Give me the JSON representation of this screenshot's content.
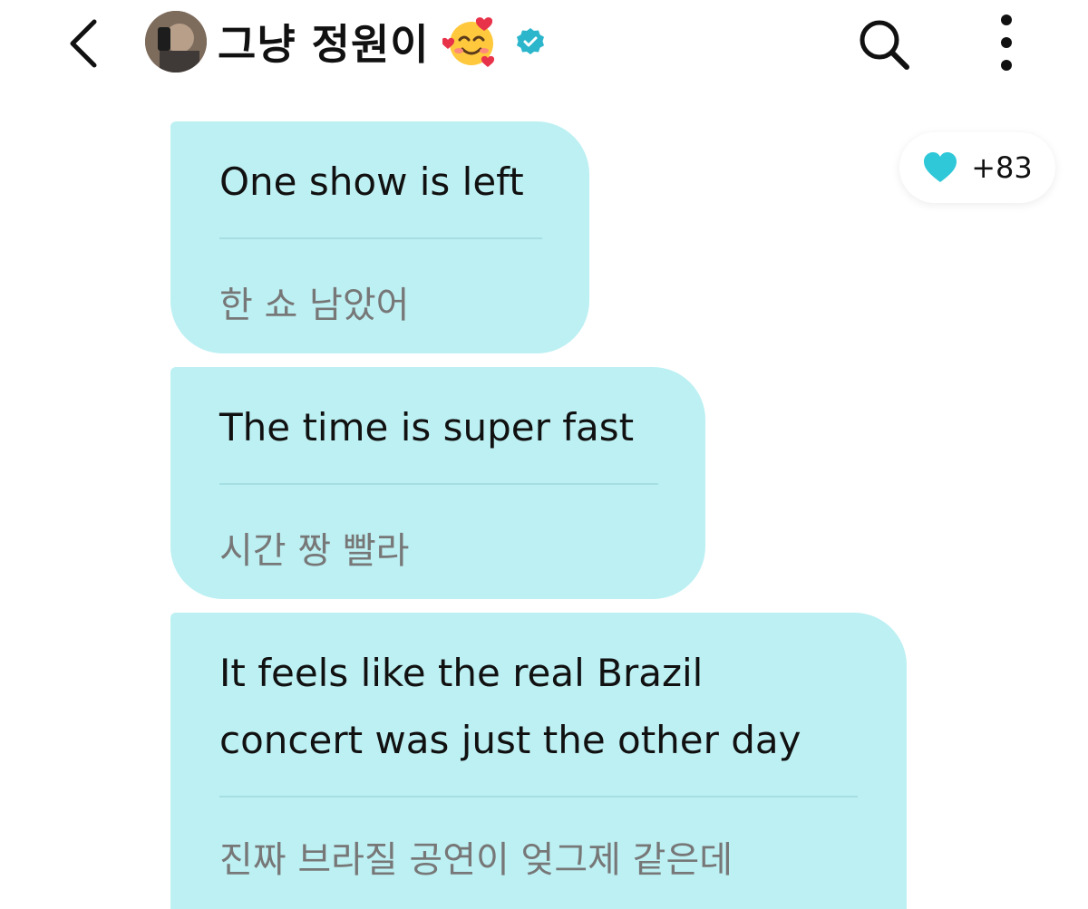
{
  "header": {
    "title": "그냥 정원이",
    "back_icon": "chevron-left-icon",
    "search_icon": "search-icon",
    "more_icon": "more-vertical-icon",
    "verified_color": "#2bb6cc"
  },
  "reaction": {
    "icon": "heart-icon",
    "count": "+83",
    "heart_color": "#2ec8d8"
  },
  "messages": [
    {
      "en": "One show is left",
      "ko": "한 쇼 남았어"
    },
    {
      "en": "The time is super fast",
      "ko": "시간 짱 빨라"
    },
    {
      "en_line1": "It feels like the real Brazil",
      "en_line2": "concert was just the other day",
      "ko": "진짜 브라질 공연이 엊그제 같은데"
    }
  ],
  "colors": {
    "bubble": "#bdf0f3",
    "translation_text": "#777777"
  }
}
